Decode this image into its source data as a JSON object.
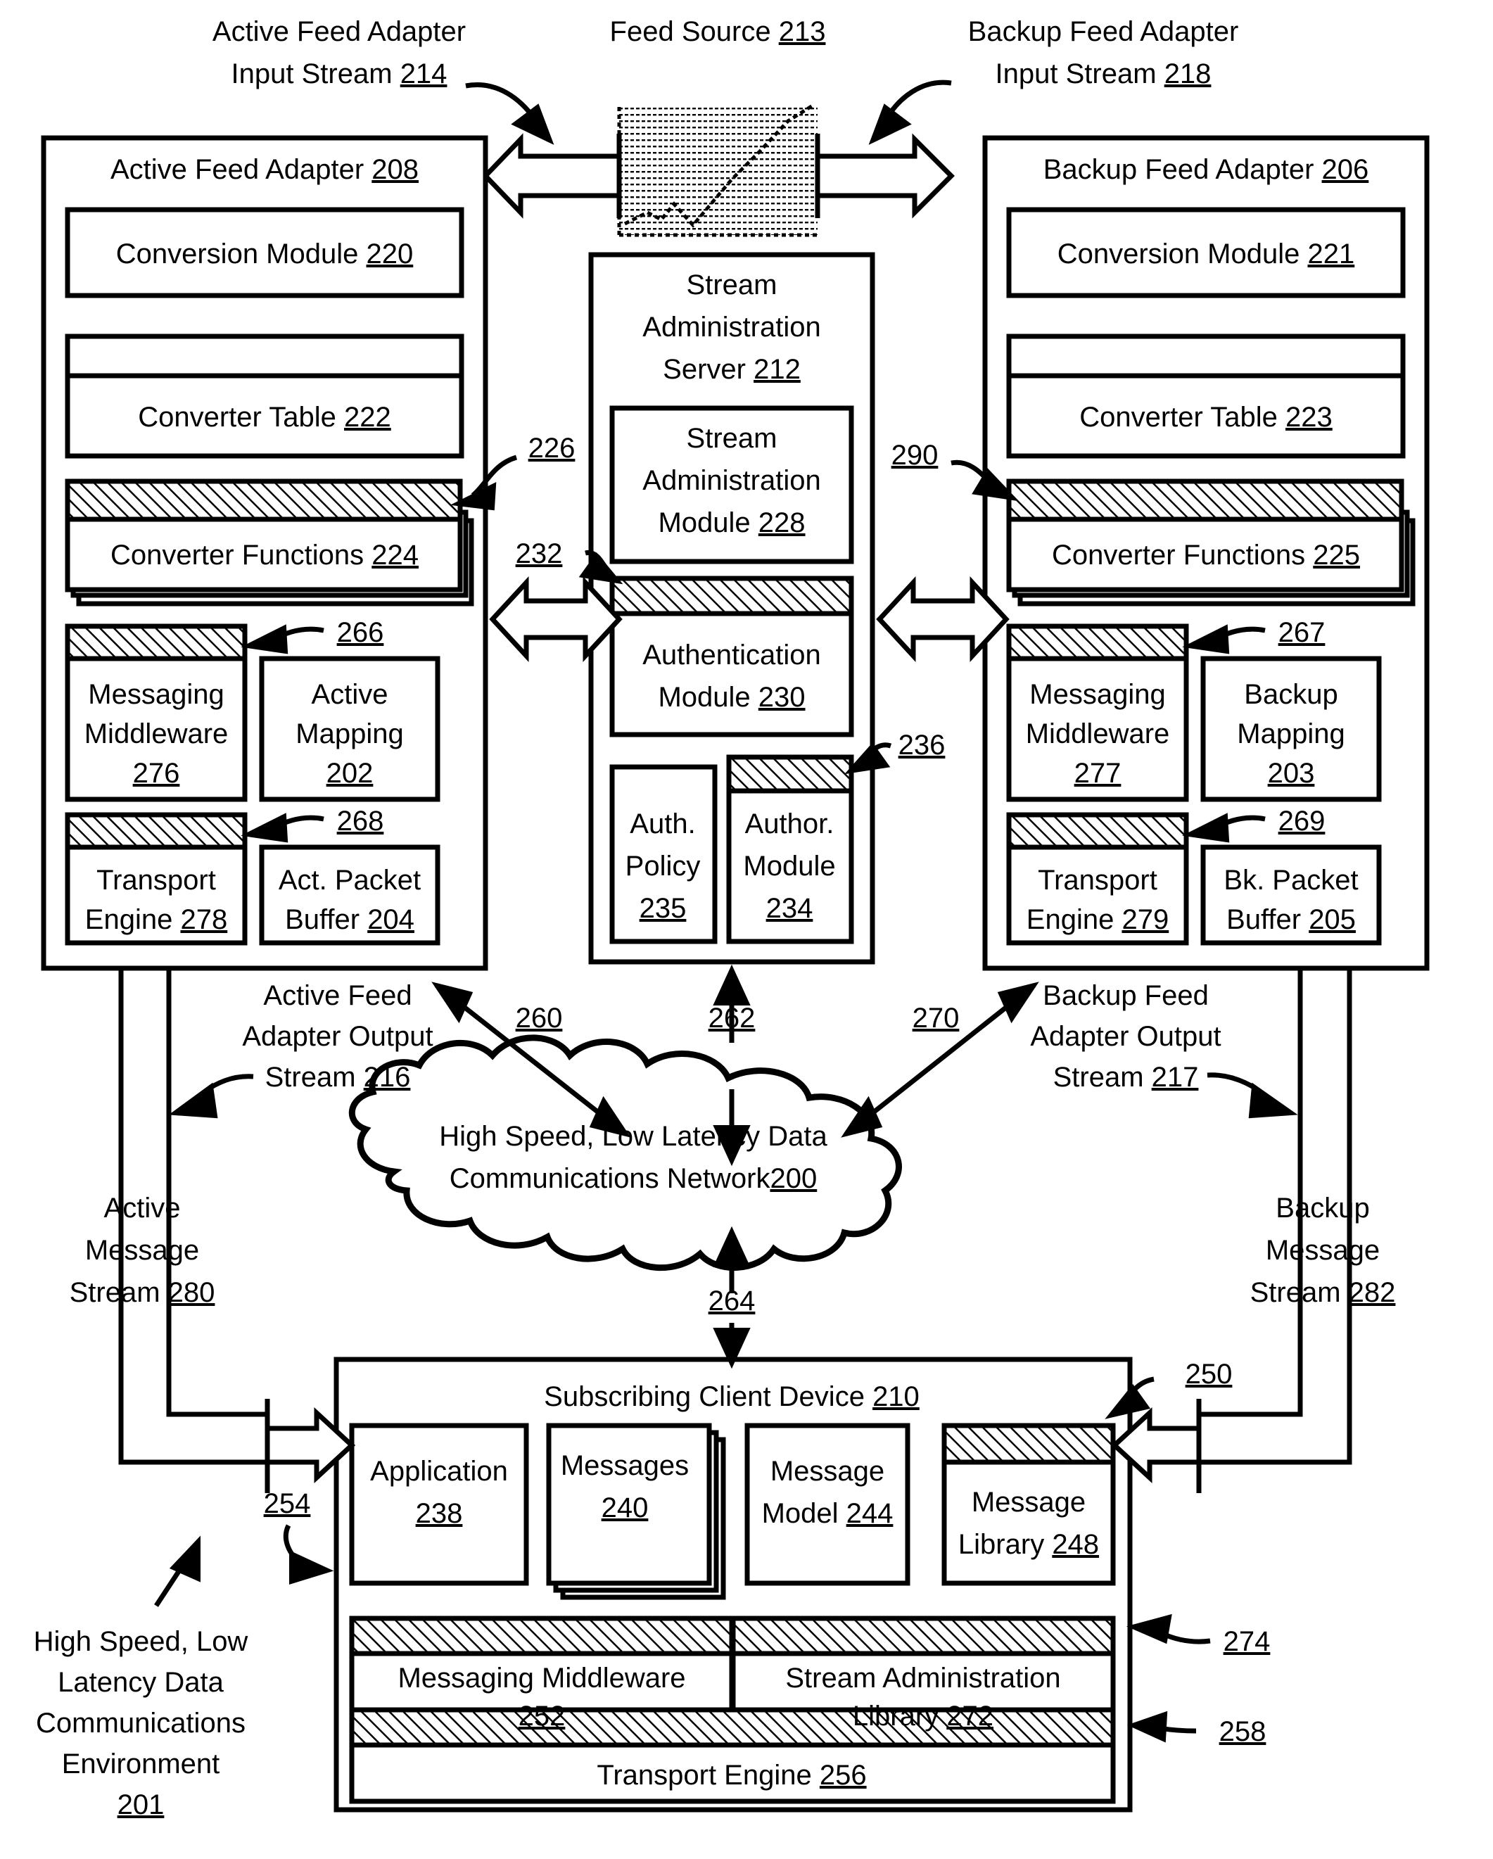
{
  "figure": {
    "environment_label": [
      "High Speed, Low",
      "Latency Data",
      "Communications",
      "Environment",
      "201"
    ],
    "environment_ref": "201"
  },
  "feed_source": {
    "label": "Feed Source",
    "ref": "213",
    "icon": "line-chart-icon"
  },
  "streams": {
    "active_input": {
      "lines": [
        "Active Feed Adapter",
        "Input Stream"
      ],
      "ref": "214"
    },
    "backup_input": {
      "lines": [
        "Backup Feed Adapter",
        "Input Stream"
      ],
      "ref": "218"
    },
    "active_output": {
      "lines": [
        "Active Feed",
        "Adapter Output",
        "Stream"
      ],
      "ref": "216"
    },
    "backup_output": {
      "lines": [
        "Backup Feed",
        "Adapter Output",
        "Stream"
      ],
      "ref": "217"
    },
    "active_message": {
      "lines": [
        "Active",
        "Message",
        "Stream"
      ],
      "ref": "280"
    },
    "backup_message": {
      "lines": [
        "Backup",
        "Message",
        "Stream"
      ],
      "ref": "282"
    }
  },
  "active_adapter": {
    "title": "Active Feed Adapter",
    "ref": "208",
    "conversion_module": {
      "label": "Conversion Module",
      "ref": "220"
    },
    "converter_table": {
      "label": "Converter Table",
      "ref": "222"
    },
    "converter_functions": {
      "label": "Converter Functions",
      "ref": "224",
      "callout_ref": "226"
    },
    "messaging_middleware": {
      "lines": [
        "Messaging",
        "Middleware"
      ],
      "ref": "276",
      "callout_ref": "266"
    },
    "active_mapping": {
      "lines": [
        "Active",
        "Mapping"
      ],
      "ref": "202"
    },
    "transport_engine": {
      "lines": [
        "Transport",
        "Engine"
      ],
      "ref": "278",
      "callout_ref": "268"
    },
    "packet_buffer": {
      "lines": [
        "Act. Packet",
        "Buffer"
      ],
      "ref": "204"
    }
  },
  "backup_adapter": {
    "title": "Backup Feed Adapter",
    "ref": "206",
    "conversion_module": {
      "label": "Conversion Module",
      "ref": "221"
    },
    "converter_table": {
      "label": "Converter Table",
      "ref": "223"
    },
    "converter_functions": {
      "label": "Converter Functions",
      "ref": "225",
      "callout_ref": "290"
    },
    "messaging_middleware": {
      "lines": [
        "Messaging",
        "Middleware"
      ],
      "ref": "277",
      "callout_ref": "267"
    },
    "backup_mapping": {
      "lines": [
        "Backup",
        "Mapping"
      ],
      "ref": "203"
    },
    "transport_engine": {
      "lines": [
        "Transport",
        "Engine"
      ],
      "ref": "279",
      "callout_ref": "269"
    },
    "packet_buffer": {
      "lines": [
        "Bk. Packet",
        "Buffer"
      ],
      "ref": "205"
    }
  },
  "stream_admin_server": {
    "title_lines": [
      "Stream",
      "Administration",
      "Server"
    ],
    "ref": "212",
    "admin_module": {
      "lines": [
        "Stream",
        "Administration",
        "Module"
      ],
      "ref": "228"
    },
    "auth_module": {
      "lines": [
        "Authentication",
        "Module"
      ],
      "ref": "230",
      "callout_ref": "232"
    },
    "auth_policy": {
      "lines": [
        "Auth.",
        "Policy"
      ],
      "ref": "235"
    },
    "author_module": {
      "lines": [
        "Author.",
        "Module"
      ],
      "ref": "234",
      "callout_ref": "236"
    }
  },
  "network": {
    "lines": [
      "High Speed, Low Latency Data",
      "Communications Network"
    ],
    "ref": "200"
  },
  "client": {
    "title": "Subscribing Client Device",
    "ref": "210",
    "application": {
      "label": "Application",
      "ref": "238"
    },
    "messages": {
      "label": "Messages",
      "ref": "240"
    },
    "message_model": {
      "lines": [
        "Message",
        "Model"
      ],
      "ref": "244"
    },
    "message_library": {
      "lines": [
        "Message",
        "Library"
      ],
      "ref": "248",
      "callout_ref": "250"
    },
    "messaging_middleware": {
      "label": "Messaging Middleware",
      "ref": "252",
      "callout_ref": "254"
    },
    "stream_admin_library": {
      "lines": [
        "Stream Administration",
        "Library"
      ],
      "ref": "272",
      "callout_ref": "274"
    },
    "transport_engine": {
      "label": "Transport Engine",
      "ref": "256",
      "callout_ref": "258"
    }
  },
  "connector_refs": {
    "active_to_network": "260",
    "server_to_network": "262",
    "backup_to_network": "270",
    "network_to_client": "264"
  }
}
